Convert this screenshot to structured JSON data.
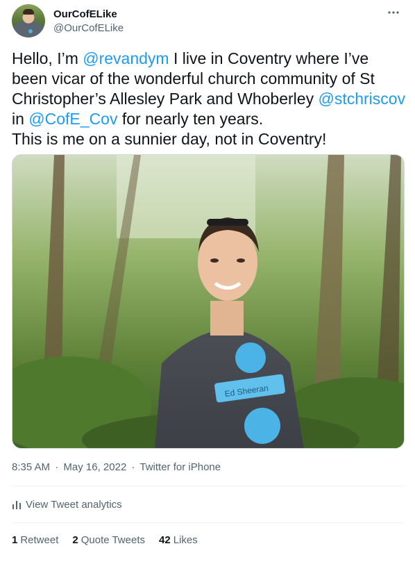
{
  "author": {
    "display_name": "OurCofELike",
    "handle": "@OurCofELike",
    "avatar_icon": "avatar"
  },
  "tweet": {
    "text_parts": [
      {
        "t": "Hello, I’m ",
        "k": "plain"
      },
      {
        "t": "@revandym",
        "k": "mention"
      },
      {
        "t": " I live in Coventry where I’ve been vicar of the wonderful church community of St Christopher’s Allesley Park and Whoberley ",
        "k": "plain"
      },
      {
        "t": "@stchriscov",
        "k": "mention"
      },
      {
        "t": " in ",
        "k": "plain"
      },
      {
        "t": "@CofE_Cov",
        "k": "mention"
      },
      {
        "t": " for nearly ten years.",
        "k": "plain"
      },
      {
        "t": "\nThis is me on a sunnier day, not in Coventry!",
        "k": "plain"
      }
    ],
    "image_text": "Ed Sheeran",
    "time": "8:35 AM",
    "date": "May 16, 2022",
    "source": "Twitter for iPhone"
  },
  "analytics": {
    "label": "View Tweet analytics"
  },
  "stats": {
    "retweets_count": "1",
    "retweets_label": "Retweet",
    "quotes_count": "2",
    "quotes_label": "Quote Tweets",
    "likes_count": "42",
    "likes_label": "Likes"
  },
  "colors": {
    "accent": "#1d9bf0",
    "text": "#0f1419",
    "secondary": "#536471",
    "divider": "#eff3f4",
    "tee_print": "#4bb3e6"
  }
}
